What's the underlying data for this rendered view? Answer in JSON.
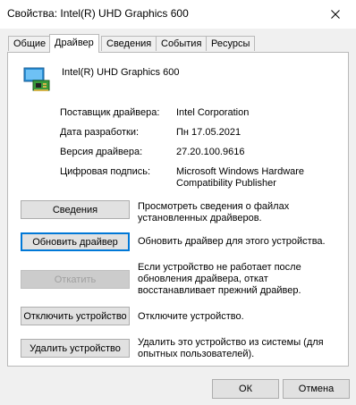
{
  "window": {
    "title": "Свойства: Intel(R) UHD Graphics 600"
  },
  "tabs": [
    {
      "label": "Общие",
      "active": false
    },
    {
      "label": "Драйвер",
      "active": true
    },
    {
      "label": "Сведения",
      "active": false
    },
    {
      "label": "События",
      "active": false
    },
    {
      "label": "Ресурсы",
      "active": false
    }
  ],
  "device": {
    "name": "Intel(R) UHD Graphics 600",
    "icon": "display-adapter-icon"
  },
  "properties": [
    {
      "label": "Поставщик драйвера:",
      "value": "Intel Corporation"
    },
    {
      "label": "Дата разработки:",
      "value": "Пн 17.05.2021"
    },
    {
      "label": "Версия драйвера:",
      "value": "27.20.100.9616"
    },
    {
      "label": "Цифровая подпись:",
      "value": "Microsoft Windows Hardware Compatibility Publisher"
    }
  ],
  "actions": [
    {
      "label": "Сведения",
      "description": "Просмотреть сведения о файлах установленных драйверов.",
      "enabled": true,
      "focused": false
    },
    {
      "label": "Обновить драйвер",
      "description": "Обновить драйвер для этого устройства.",
      "enabled": true,
      "focused": true
    },
    {
      "label": "Откатить",
      "description": "Если устройство не работает после обновления драйвера, откат восстанавливает прежний драйвер.",
      "enabled": false,
      "focused": false
    },
    {
      "label": "Отключить устройство",
      "description": "Отключите устройство.",
      "enabled": true,
      "focused": false
    },
    {
      "label": "Удалить устройство",
      "description": "Удалить это устройство из системы (для опытных пользователей).",
      "enabled": true,
      "focused": false
    }
  ],
  "footer": {
    "ok_label": "ОК",
    "cancel_label": "Отмена"
  },
  "colors": {
    "accent": "#0078d7",
    "window_bg": "#f0f0f0",
    "button_bg": "#e1e1e1"
  }
}
